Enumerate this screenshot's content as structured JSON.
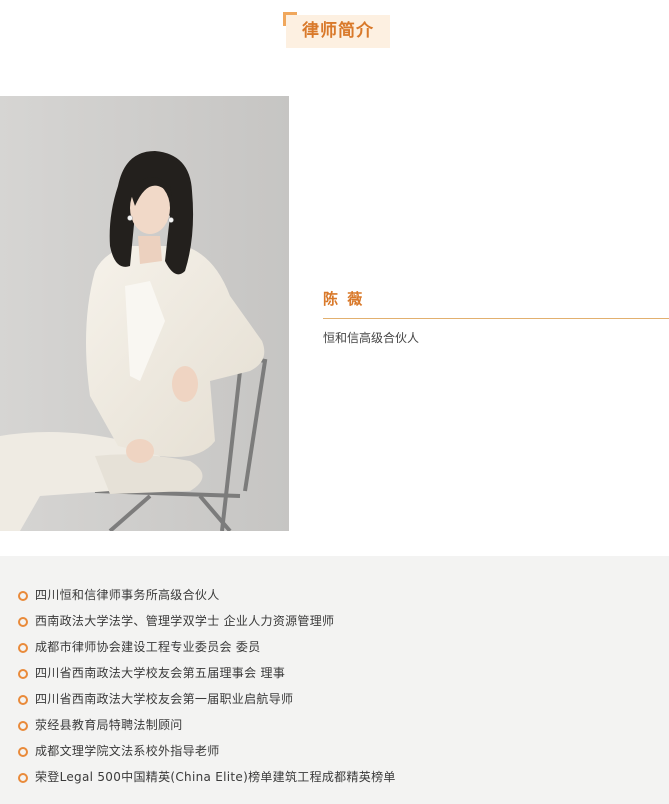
{
  "header": {
    "title": "律师简介"
  },
  "profile": {
    "name": "陈 薇",
    "role": "恒和信高级合伙人"
  },
  "bio": {
    "items": [
      "四川恒和信律师事务所高级合伙人",
      "西南政法大学法学、管理学双学士  企业人力资源管理师",
      "成都市律师协会建设工程专业委员会  委员",
      "四川省西南政法大学校友会第五届理事会  理事",
      "四川省西南政法大学校友会第一届职业启航导师",
      "荥经县教育局特聘法制顾问",
      "成都文理学院文法系校外指导老师",
      "荣登Legal 500中国精英(China Elite)榜单建筑工程成都精英榜单"
    ]
  },
  "colors": {
    "accent": "#d9792a",
    "accent_light": "#fdf0e1",
    "divider": "#e2b06f",
    "bio_bg": "#f3f3f2",
    "bullet": "#e98a3a"
  }
}
